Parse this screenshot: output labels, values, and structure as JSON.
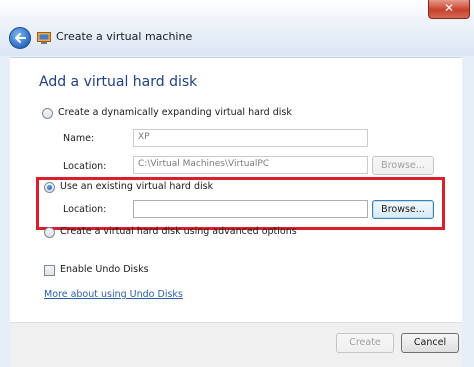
{
  "window": {
    "title": "Create a virtual machine",
    "close_label": "✕"
  },
  "page": {
    "heading": "Add a virtual hard disk"
  },
  "option_dynamic": {
    "label": "Create a dynamically expanding virtual hard disk",
    "selected": false,
    "name_label": "Name:",
    "name_value": "XP",
    "location_label": "Location:",
    "location_value": "C:\\Virtual Machines\\VirtualPC",
    "browse_label": "Browse..."
  },
  "option_existing": {
    "label": "Use an existing virtual hard disk",
    "selected": true,
    "location_label": "Location:",
    "location_value": "",
    "browse_label": "Browse..."
  },
  "option_advanced": {
    "label": "Create a virtual hard disk using advanced options",
    "selected": false
  },
  "undo": {
    "checkbox_label": "Enable Undo Disks",
    "checked": false,
    "link_text": "More about using Undo Disks"
  },
  "footer": {
    "create_label": "Create",
    "cancel_label": "Cancel"
  },
  "colors": {
    "highlight_border": "#d81f2a",
    "heading": "#1e3f8a",
    "link": "#2a5db0"
  },
  "icons": {
    "back": "back-arrow-icon",
    "app": "virtual-pc-icon",
    "close": "close-icon"
  }
}
